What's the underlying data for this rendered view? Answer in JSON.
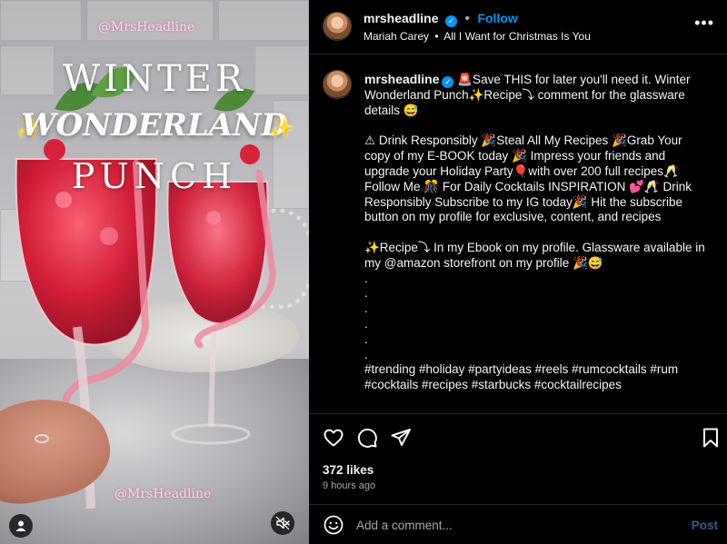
{
  "media": {
    "watermark_top": "@MrsHeadline",
    "watermark_bottom": "@MrsHeadline",
    "title_line1": "WINTER",
    "title_line2": "WONDERLAND",
    "title_line3": "PUNCH",
    "sparkle": "✨",
    "user_tag_icon": "person-icon",
    "mute_icon": "speaker-muted-icon"
  },
  "header": {
    "username": "mrsheadline",
    "separator": "•",
    "follow_label": "Follow",
    "music_artist": "Mariah Carey",
    "music_dot": "•",
    "music_song": "All I Want for Christmas Is You",
    "more_label": "•••"
  },
  "caption": {
    "username": "mrsheadline",
    "lines": [
      "🚨Save THIS for later you'll need it. Winter Wonderland Punch✨Recipe⤵ comment for the glassware details 😅",
      "",
      "⚠ Drink Responsibly 🎉Steal All My Recipes 🎉Grab Your copy of my E-BOOK today 🎉 Impress your friends and upgrade your Holiday Party🎈with over 200 full recipes🥂Follow Me 🎊 For Daily Cocktails INSPIRATION 💕🥂 Drink Responsibly Subscribe to my IG today🎉 Hit the subscribe button on my profile for exclusive, content, and recipes",
      "",
      "✨Recipe⤵ In my Ebook on my profile. Glassware available in my @amazon storefront on my profile 🎉😅",
      ".",
      ".",
      ".",
      ".",
      ".",
      ".",
      "#trending #holiday #partyideas #reels #rumcocktails #rum #cocktails #recipes #starbucks #cocktailrecipes"
    ]
  },
  "actions": {
    "like_icon": "heart-icon",
    "comment_icon": "comment-icon",
    "share_icon": "send-icon",
    "save_icon": "bookmark-icon",
    "likes": "372 likes",
    "time": "9 hours ago"
  },
  "comment": {
    "emoji_icon": "smiley-icon",
    "placeholder": "Add a comment...",
    "post_label": "Post"
  },
  "colors": {
    "accent": "#0095f6",
    "post_disabled": "#315e86",
    "background": "#000000",
    "divider": "#262626",
    "punch": "#c8102e"
  }
}
